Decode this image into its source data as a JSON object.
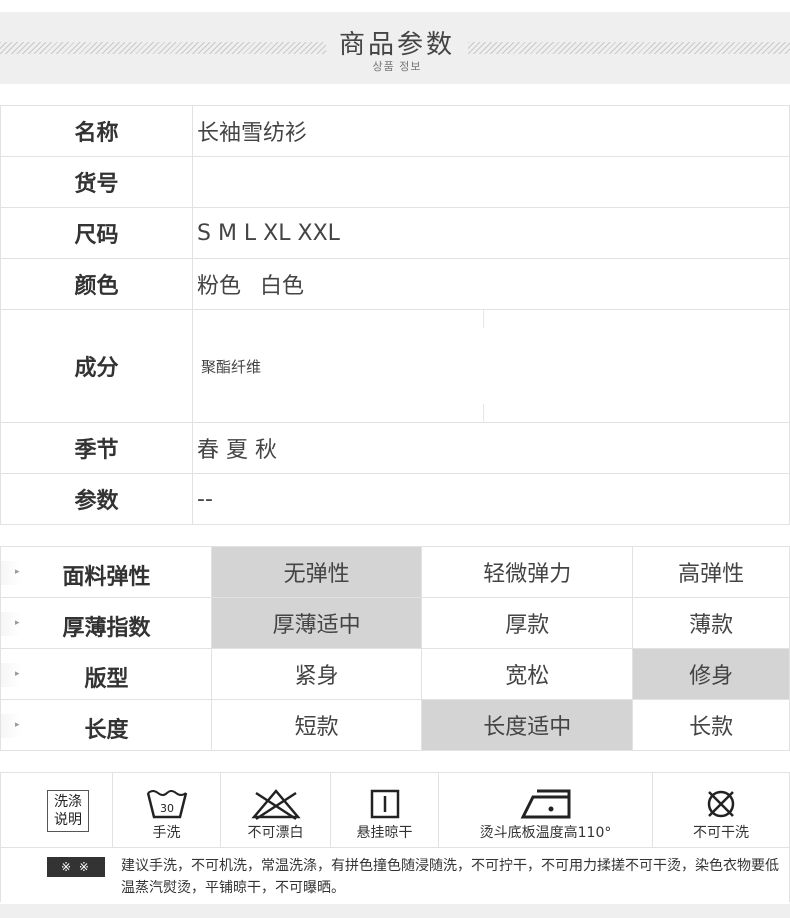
{
  "header": {
    "title": "商品参数",
    "subtitle": "상품 정보"
  },
  "info": [
    {
      "label": "名称",
      "value": "长袖雪纺衫"
    },
    {
      "label": "货号",
      "value": ""
    },
    {
      "label": "尺码",
      "value": "S M L XL XXL"
    },
    {
      "label": "颜色",
      "value": "粉色 白色"
    },
    {
      "label": "成分",
      "value": "聚酯纤维"
    },
    {
      "label": "季节",
      "value": "春 夏 秋"
    },
    {
      "label": "参数",
      "value": "--"
    }
  ],
  "attributes": [
    {
      "name": "面料弹性",
      "options": [
        "无弹性",
        "轻微弹力",
        "高弹性"
      ],
      "selected": 0
    },
    {
      "name": "厚薄指数",
      "options": [
        "厚薄适中",
        "厚款",
        "薄款"
      ],
      "selected": 0
    },
    {
      "name": "版型",
      "options": [
        "紧身",
        "宽松",
        "修身"
      ],
      "selected": 2
    },
    {
      "name": "长度",
      "options": [
        "短款",
        "长度适中",
        "长款"
      ],
      "selected": 1
    }
  ],
  "care": {
    "legend": "洗涤说明",
    "items": [
      {
        "icon": "wash-30-icon",
        "label": "手洗",
        "tub_number": "30"
      },
      {
        "icon": "no-bleach-icon",
        "label": "不可漂白"
      },
      {
        "icon": "hang-dry-icon",
        "label": "悬挂晾干"
      },
      {
        "icon": "iron-icon",
        "label": "烫斗底板温度高110°"
      },
      {
        "icon": "no-dry-clean-icon",
        "label": "不可干洗"
      }
    ],
    "note_mark": "※ ※",
    "note": "建议手洗，不可机洗，常温洗涤，有拼色撞色随浸随洗，不可拧干，不可用力揉搓不可干烫，染色衣物要低温蒸汽熨烫，平铺晾干，不可曝晒。"
  },
  "colors": {
    "selected_cell": "#d4d4d4",
    "header_bg": "#efefef",
    "border": "#e2e2e2"
  }
}
